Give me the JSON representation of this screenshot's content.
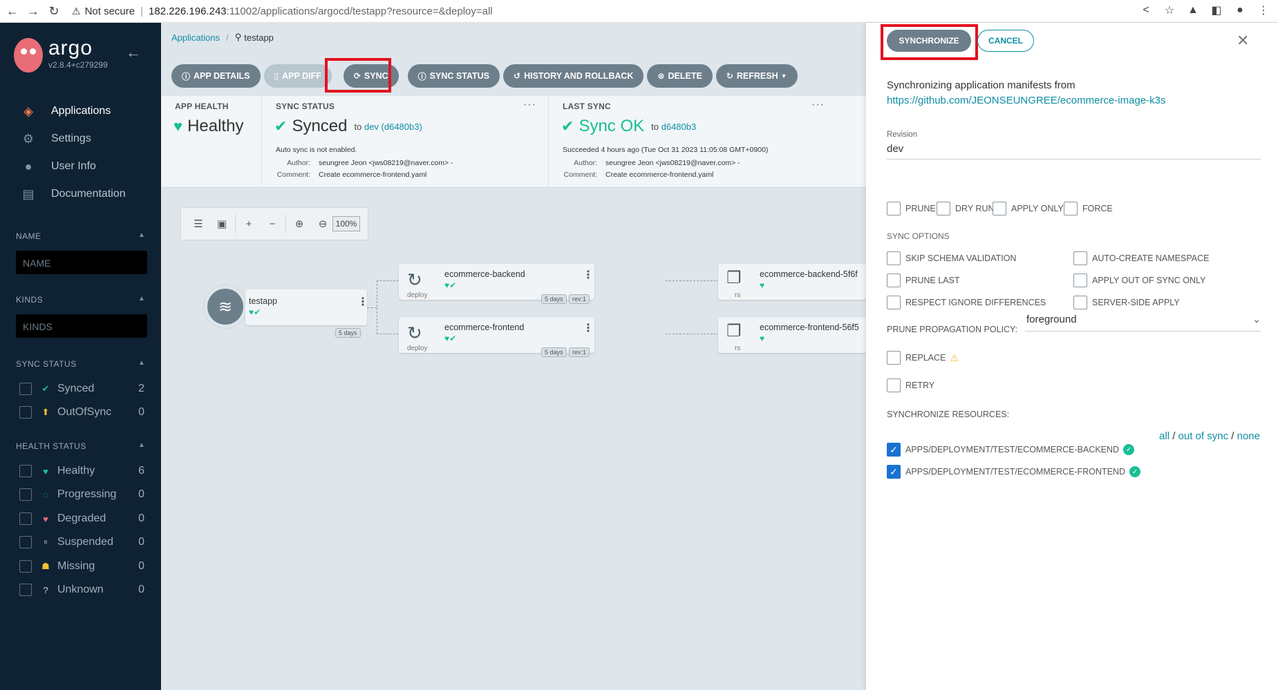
{
  "browser": {
    "security": "Not secure",
    "url_host": "182.226.196.243",
    "url_rest": ":11002/applications/argocd/testapp?resource=&deploy=all"
  },
  "sidebar": {
    "logo": "argo",
    "version": "v2.8.4+c279299",
    "nav": [
      {
        "label": "Applications",
        "icon": "layers-icon"
      },
      {
        "label": "Settings",
        "icon": "gear-icon"
      },
      {
        "label": "User Info",
        "icon": "user-icon"
      },
      {
        "label": "Documentation",
        "icon": "doc-icon"
      }
    ],
    "name_title": "NAME",
    "name_placeholder": "NAME",
    "kinds_title": "KINDS",
    "kinds_placeholder": "KINDS",
    "sync_title": "SYNC STATUS",
    "sync_filters": [
      {
        "label": "Synced",
        "count": "2"
      },
      {
        "label": "OutOfSync",
        "count": "0"
      }
    ],
    "health_title": "HEALTH STATUS",
    "health_filters": [
      {
        "label": "Healthy",
        "count": "6"
      },
      {
        "label": "Progressing",
        "count": "0"
      },
      {
        "label": "Degraded",
        "count": "0"
      },
      {
        "label": "Suspended",
        "count": "0"
      },
      {
        "label": "Missing",
        "count": "0"
      },
      {
        "label": "Unknown",
        "count": "0"
      }
    ]
  },
  "breadcrumb": {
    "root": "Applications",
    "current": "testapp"
  },
  "actions": {
    "app_details": "APP DETAILS",
    "app_diff": "APP DIFF",
    "sync": "SYNC",
    "sync_status": "SYNC STATUS",
    "history": "HISTORY AND ROLLBACK",
    "delete": "DELETE",
    "refresh": "REFRESH"
  },
  "info": {
    "app_health_title": "APP HEALTH",
    "app_health": "Healthy",
    "sync_status_title": "SYNC STATUS",
    "sync_status": "Synced",
    "sync_to_prefix": "to",
    "sync_to": "dev (d6480b3)",
    "auto_sync": "Auto sync is not enabled.",
    "author_key": "Author:",
    "author": "seungree Jeon <jws08219@naver.com> -",
    "comment_key": "Comment:",
    "comment": "Create ecommerce-frontend.yaml",
    "last_sync_title": "LAST SYNC",
    "last_sync": "Sync OK",
    "last_sync_to_prefix": "to",
    "last_sync_to": "d6480b3",
    "succeeded": "Succeeded 4 hours ago (Tue Oct 31 2023 11:05:08 GMT+0900)",
    "last_author": "seungree Jeon <jws08219@naver.com> -",
    "last_comment": "Create ecommerce-frontend.yaml"
  },
  "graph": {
    "zoom": "100%",
    "app_node": {
      "name": "testapp",
      "age": "5 days"
    },
    "deploy_nodes": [
      {
        "name": "ecommerce-backend",
        "kind": "deploy",
        "age": "5 days",
        "rev": "rev:1"
      },
      {
        "name": "ecommerce-frontend",
        "kind": "deploy",
        "age": "5 days",
        "rev": "rev:1"
      }
    ],
    "rs_nodes": [
      {
        "name": "ecommerce-backend-5f6f",
        "kind": "rs"
      },
      {
        "name": "ecommerce-frontend-56f5",
        "kind": "rs"
      }
    ]
  },
  "panel": {
    "synchronize": "SYNCHRONIZE",
    "cancel": "CANCEL",
    "from_text": "Synchronizing application manifests from",
    "repo_url": "https://github.com/JEONSEUNGREE/ecommerce-image-k3s",
    "revision_label": "Revision",
    "revision": "dev",
    "top_options": [
      "PRUNE",
      "DRY RUN",
      "APPLY ONLY",
      "FORCE"
    ],
    "sync_options_title": "SYNC OPTIONS",
    "sync_options_left": [
      "SKIP SCHEMA VALIDATION",
      "PRUNE LAST",
      "RESPECT IGNORE DIFFERENCES"
    ],
    "sync_options_right": [
      "AUTO-CREATE NAMESPACE",
      "APPLY OUT OF SYNC ONLY",
      "SERVER-SIDE APPLY"
    ],
    "prune_policy_label": "PRUNE PROPAGATION POLICY:",
    "prune_policy": "foreground",
    "replace": "REPLACE",
    "retry": "RETRY",
    "resources_title": "SYNCHRONIZE RESOURCES:",
    "res_all": "all",
    "res_out": "out of sync",
    "res_none": "none",
    "resources": [
      "APPS/DEPLOYMENT/TEST/ECOMMERCE-BACKEND",
      "APPS/DEPLOYMENT/TEST/ECOMMERCE-FRONTEND"
    ]
  },
  "colors": {
    "sidebar_bg": "#0e2233",
    "accent": "#0f8ea4",
    "healthy": "#18be94",
    "highlight": "#e3121f"
  }
}
